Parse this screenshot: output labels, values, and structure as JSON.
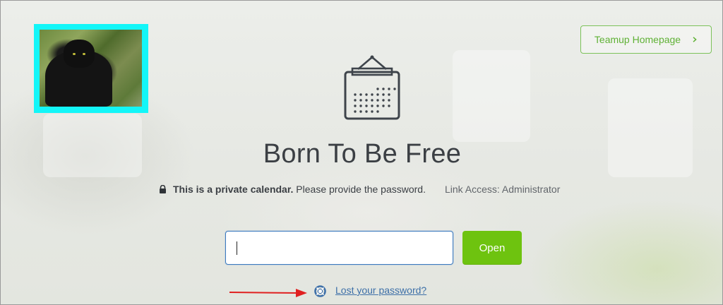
{
  "logo": {
    "icon": "panther-photo"
  },
  "header": {
    "homepage_button_label": "Teamup Homepage",
    "homepage_icon": "chevron-right-icon"
  },
  "calendar": {
    "icon": "calendar-icon",
    "title": "Born To Be Free",
    "private_notice_bold": "This is a private calendar.",
    "private_notice_rest": " Please provide the password.",
    "link_access": "Link Access: Administrator"
  },
  "form": {
    "password_value": "",
    "password_placeholder": "",
    "open_label": "Open",
    "lost_password_label": "Lost your password?"
  },
  "colors": {
    "accent_green": "#6ec30f",
    "outline_green": "#7cc25a",
    "logo_border": "#13f6f8",
    "link_blue": "#3d6fa8",
    "annotation_red": "#e02020"
  }
}
